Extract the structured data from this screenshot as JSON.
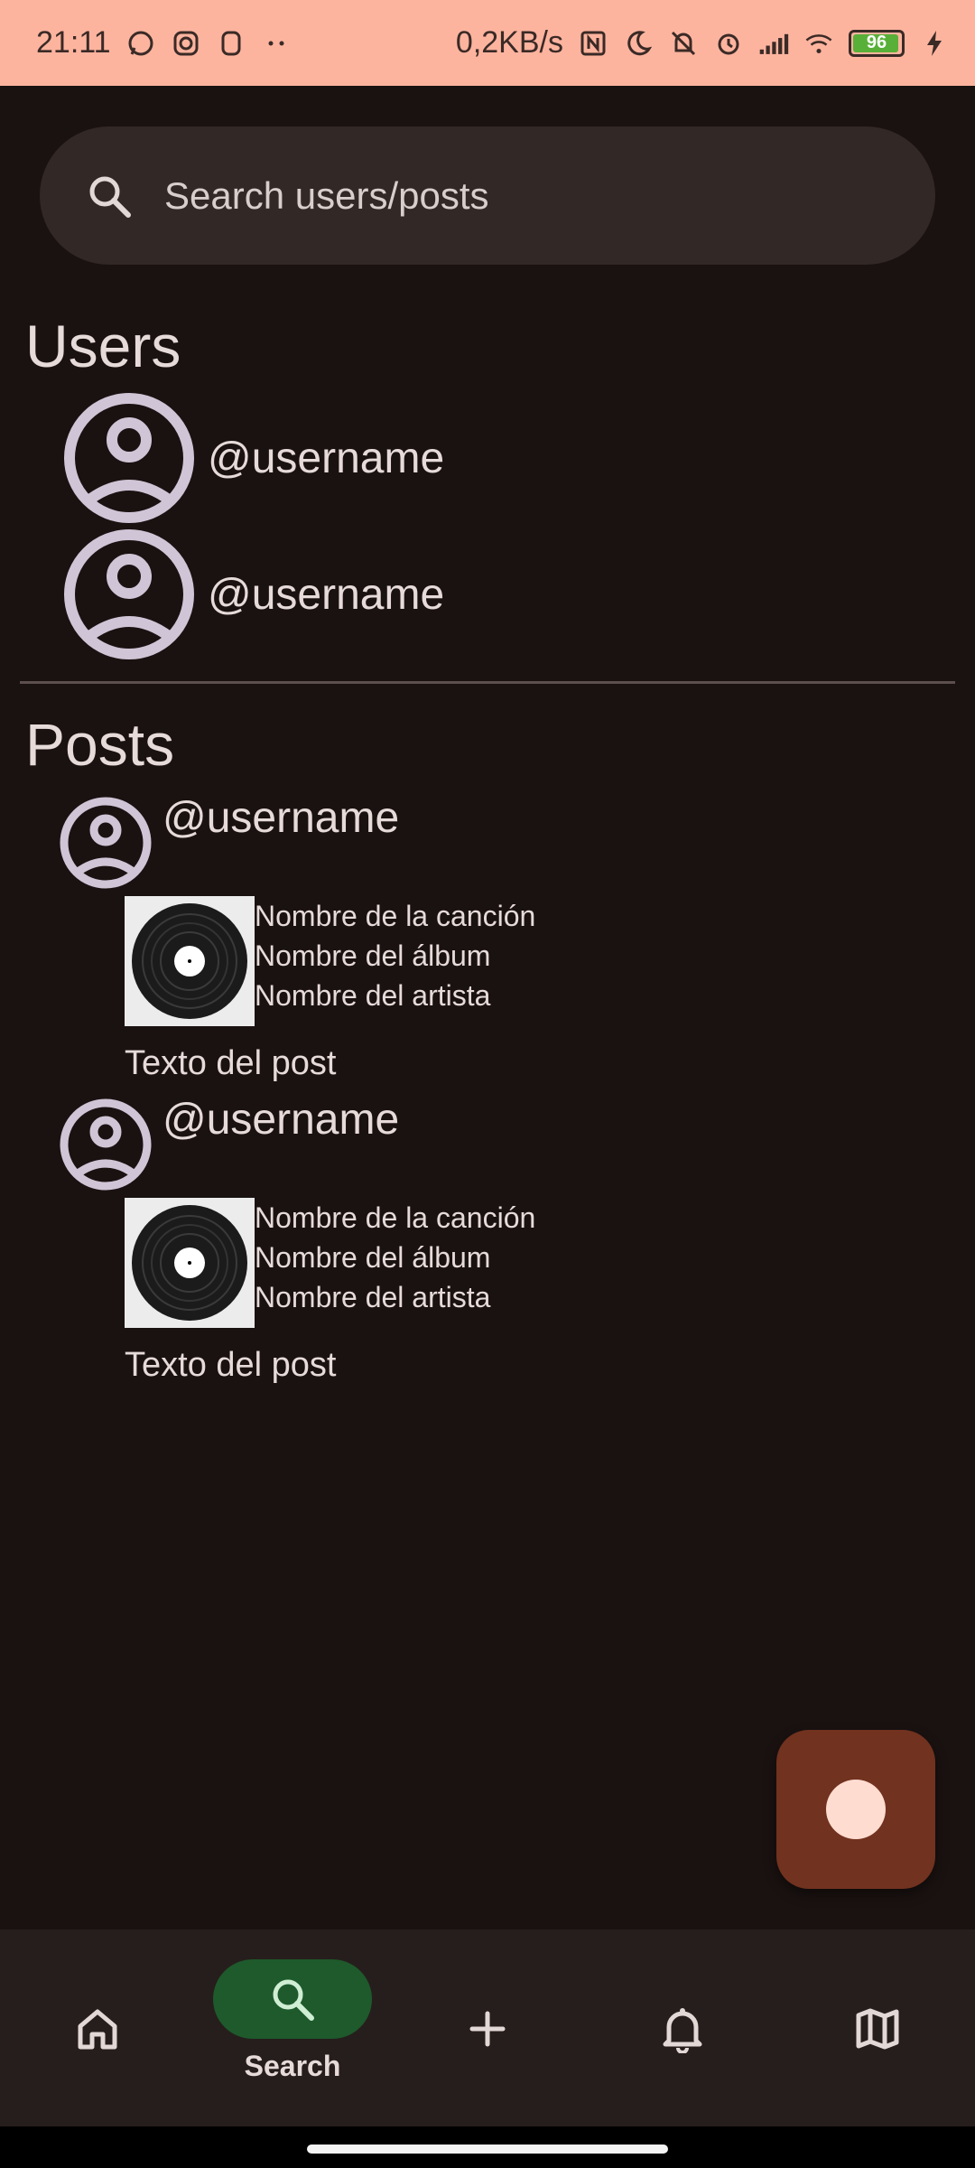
{
  "status_bar": {
    "time": "21:11",
    "net_speed": "0,2KB/s",
    "battery": "96",
    "icons": [
      "whatsapp-icon",
      "instagram-icon",
      "notification-icon",
      "more-dots-icon",
      "nfc-icon",
      "moon-icon",
      "mute-icon",
      "alarm-icon",
      "signal-icon",
      "wifi-icon",
      "battery-icon",
      "charging-icon"
    ],
    "background_color": "#fdb49f"
  },
  "search": {
    "placeholder": "Search users/posts",
    "value": ""
  },
  "users_section": {
    "title": "Users",
    "items": [
      {
        "username": "@username"
      },
      {
        "username": "@username"
      }
    ]
  },
  "posts_section": {
    "title": "Posts",
    "items": [
      {
        "username": "@username",
        "song": "Nombre de la canción",
        "album": "Nombre del álbum",
        "artist": "Nombre del artista",
        "text": "Texto del post"
      },
      {
        "username": "@username",
        "song": "Nombre de la canción",
        "album": "Nombre del álbum",
        "artist": "Nombre del artista",
        "text": "Texto del post"
      }
    ]
  },
  "fab": {
    "icon": "record-icon",
    "color": "#71321f"
  },
  "bottom_nav": {
    "items": [
      {
        "icon": "home-icon",
        "label": ""
      },
      {
        "icon": "search-icon",
        "label": "Search",
        "active": true
      },
      {
        "icon": "plus-icon",
        "label": ""
      },
      {
        "icon": "bell-icon",
        "label": ""
      },
      {
        "icon": "map-icon",
        "label": ""
      }
    ],
    "active_color": "#1e5a2c"
  },
  "colors": {
    "background": "#1a1211",
    "text": "#e6dbd9",
    "avatar": "#cfc5d6"
  }
}
